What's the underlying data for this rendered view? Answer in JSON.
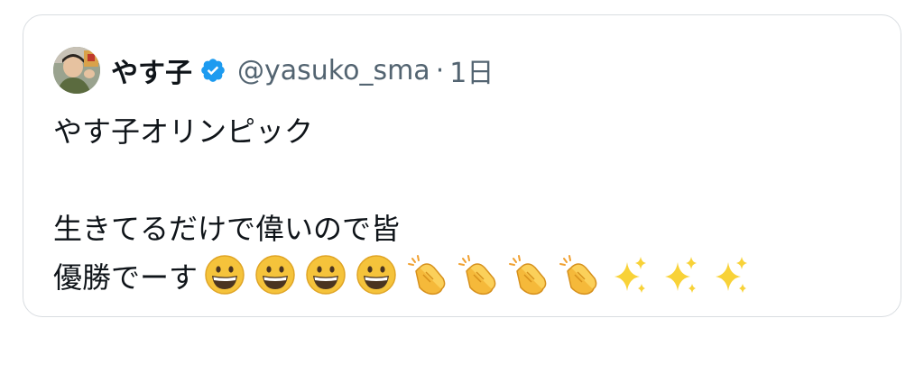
{
  "tweet": {
    "display_name": "やす子",
    "handle": "@yasuko_sma",
    "separator": "·",
    "time": "1日",
    "verified": true,
    "verified_color": "#1d9bf0",
    "avatar_icon": "user-photo",
    "text_lines": [
      "やす子オリンピック",
      "",
      "生きてるだけで偉いので皆",
      "優勝でーす"
    ],
    "emojis": [
      "grinning-face",
      "grinning-face",
      "grinning-face",
      "grinning-face",
      "clapping-hands",
      "clapping-hands",
      "clapping-hands",
      "clapping-hands",
      "sparkles",
      "sparkles",
      "sparkles"
    ]
  }
}
